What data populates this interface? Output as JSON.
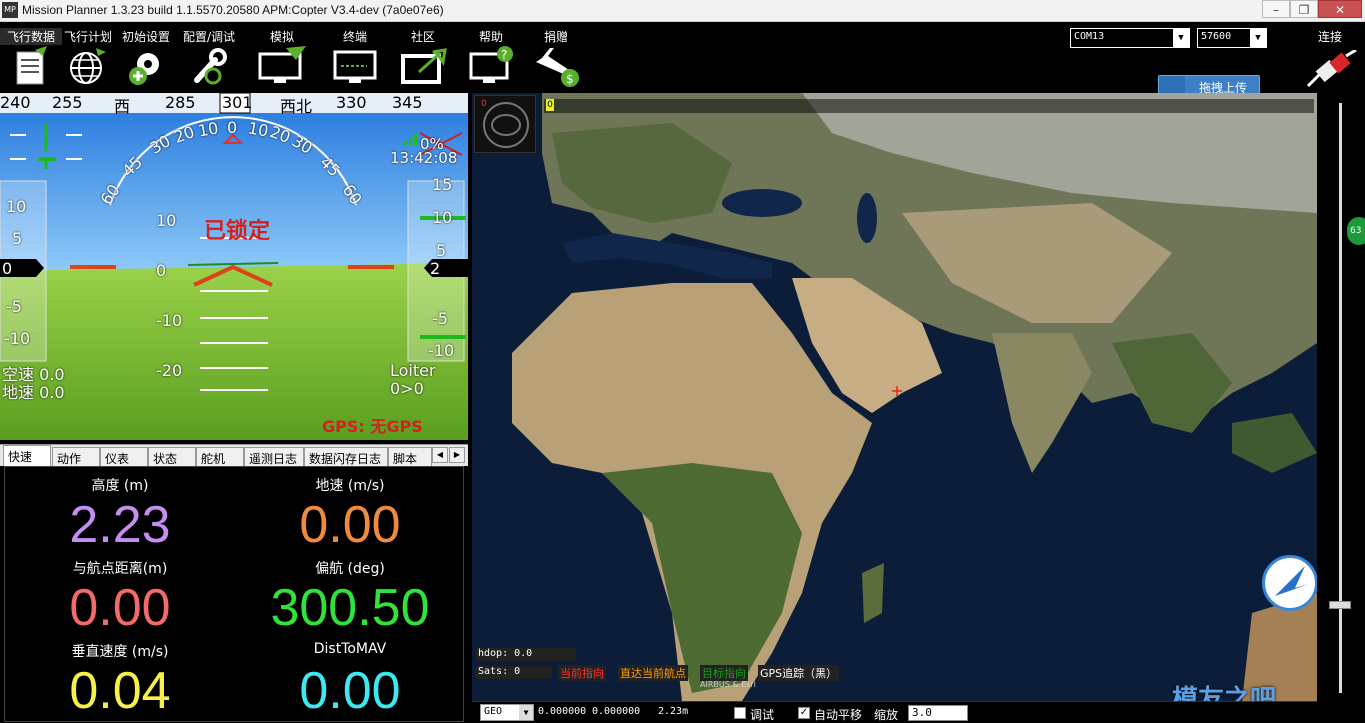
{
  "window": {
    "title": "Mission Planner 1.3.23 build 1.1.5570.20580 APM:Copter V3.4-dev (7a0e07e6)",
    "logo": "MP",
    "minimize": "–",
    "maximize": "❐",
    "close": "✕"
  },
  "menu": {
    "items": [
      {
        "label": "飞行数据",
        "icon": "flight-data-icon"
      },
      {
        "label": "飞行计划",
        "icon": "flight-plan-icon"
      },
      {
        "label": "初始设置",
        "icon": "initial-setup-icon"
      },
      {
        "label": "配置/调试",
        "icon": "config-tuning-icon"
      },
      {
        "label": "模拟",
        "icon": "simulation-icon"
      },
      {
        "label": "终端",
        "icon": "terminal-icon"
      },
      {
        "label": "社区",
        "icon": "community-icon"
      },
      {
        "label": "帮助",
        "icon": "help-icon"
      },
      {
        "label": "捐赠",
        "icon": "donate-icon"
      }
    ],
    "port": "COM13",
    "baud": "57600",
    "connect": "连接",
    "upload": "拖拽上传"
  },
  "hud": {
    "heading_ticks": [
      "240",
      "255",
      "西",
      "285",
      "301",
      "西北",
      "330",
      "345"
    ],
    "pitch_labels": [
      "10",
      "0",
      "-10",
      "-20"
    ],
    "roll_labels": [
      "60",
      "45",
      "30",
      "20",
      "10",
      "0",
      "10",
      "20",
      "30",
      "45",
      "60"
    ],
    "speed_ticks": [
      "10",
      "5",
      "-5",
      "-10"
    ],
    "speed_value": "0",
    "alt_ticks": [
      "15",
      "10",
      "5",
      "-5",
      "-10"
    ],
    "alt_value": "2",
    "armed": "已锁定",
    "battery": "0%",
    "time": "13:42:08",
    "airspeed": "空速 0.0",
    "groundspeed": "地速 0.0",
    "mode": "Loiter",
    "wp": "0>0",
    "gps": "GPS: 无GPS"
  },
  "tabs": [
    "快速",
    "动作",
    "仪表",
    "状态",
    "舵机",
    "遥测日志",
    "数据闪存日志",
    "脚本"
  ],
  "quick": [
    {
      "label": "高度 (m)",
      "value": "2.23",
      "color": "#c48ef2"
    },
    {
      "label": "地速 (m/s)",
      "value": "0.00",
      "color": "#f08a3c"
    },
    {
      "label": "与航点距离(m)",
      "value": "0.00",
      "color": "#f26a6a"
    },
    {
      "label": "偏航 (deg)",
      "value": "300.50",
      "color": "#2fe33a"
    },
    {
      "label": "垂直速度 (m/s)",
      "value": "0.04",
      "color": "#f5f04a"
    },
    {
      "label": "DistToMAV",
      "value": "0.00",
      "color": "#3ee8f0"
    }
  ],
  "map": {
    "hdop": "hdop: 0.0",
    "sats": "Sats: 0",
    "legend": [
      {
        "label": "当前指向",
        "color": "#ff3030"
      },
      {
        "label": "直达当前航点",
        "color": "#ff9a00"
      },
      {
        "label": "目标指向",
        "color": "#13a313"
      },
      {
        "label": "GPS追踪（黑）",
        "color": "#ffffff"
      }
    ],
    "attribution": "AIRBUS & Esri",
    "overlay_tag_a": "0",
    "overlay_tag_b": "0",
    "slider_value": "63",
    "watermark": "模友之吧"
  },
  "footer": {
    "coord_type": "GEO",
    "lat": "0.000000",
    "lon": "0.000000",
    "alt": "2.23m",
    "debug": "调试",
    "autopan": "自动平移",
    "zoom_label": "缩放",
    "zoom_value": "3.0"
  }
}
